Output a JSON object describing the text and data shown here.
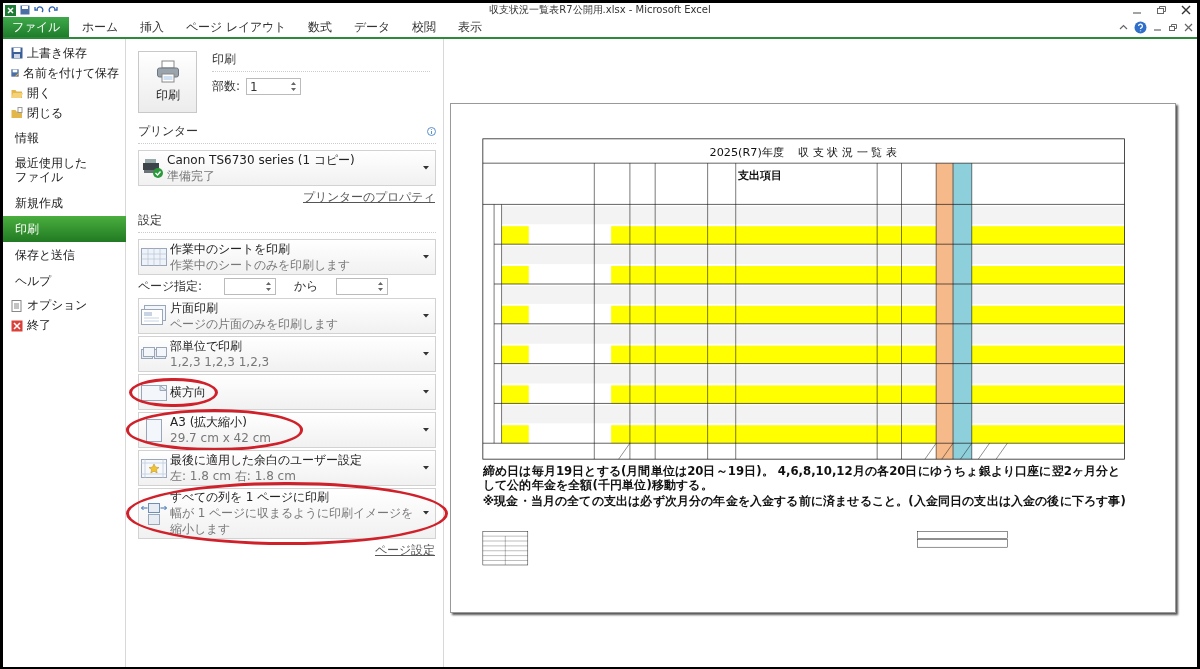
{
  "window": {
    "title": "収支状況一覧表R7公開用.xlsx  -  Microsoft Excel"
  },
  "ribbon_tabs": [
    {
      "label": "ファイル",
      "selected": true
    },
    {
      "label": "ホーム",
      "selected": false
    },
    {
      "label": "挿入",
      "selected": false
    },
    {
      "label": "ページ レイアウト",
      "selected": false
    },
    {
      "label": "数式",
      "selected": false
    },
    {
      "label": "データ",
      "selected": false
    },
    {
      "label": "校閲",
      "selected": false
    },
    {
      "label": "表示",
      "selected": false
    }
  ],
  "backstage_nav": [
    {
      "label": "上書き保存",
      "kind": "save",
      "selected": false
    },
    {
      "label": "名前を付けて保存",
      "kind": "save-as",
      "selected": false
    },
    {
      "label": "開く",
      "kind": "open",
      "selected": false
    },
    {
      "label": "閉じる",
      "kind": "close",
      "selected": false
    },
    {
      "label": "情報",
      "kind": "section",
      "selected": false
    },
    {
      "label": "最近使用したファイル",
      "kind": "section",
      "selected": false
    },
    {
      "label": "新規作成",
      "kind": "section",
      "selected": false
    },
    {
      "label": "印刷",
      "kind": "section",
      "selected": true
    },
    {
      "label": "保存と送信",
      "kind": "section",
      "selected": false
    },
    {
      "label": "ヘルプ",
      "kind": "section",
      "selected": false
    },
    {
      "label": "オプション",
      "kind": "options",
      "selected": false
    },
    {
      "label": "終了",
      "kind": "exit",
      "selected": false
    }
  ],
  "print_panel": {
    "heading": "印刷",
    "button": "印刷",
    "copies_label": "部数:",
    "copies": "1"
  },
  "printer": {
    "heading": "プリンター",
    "name": "Canon TS6730 series (1 コピー)",
    "status": "準備完了",
    "properties_link": "プリンターのプロパティ"
  },
  "settings": {
    "heading": "設定",
    "items": [
      {
        "kind": "what",
        "title": "作業中のシートを印刷",
        "subtitle": "作業中のシートのみを印刷します",
        "circled": false
      },
      {
        "kind": "page_range",
        "label": "ページ指定:",
        "to_label": "から"
      },
      {
        "kind": "sides",
        "title": "片面印刷",
        "subtitle": "ページの片面のみを印刷します",
        "circled": false
      },
      {
        "kind": "collate",
        "title": "部単位で印刷",
        "subtitle": "1,2,3    1,2,3    1,2,3",
        "circled": false
      },
      {
        "kind": "orientation",
        "title": "横方向",
        "circled": true
      },
      {
        "kind": "paper",
        "title": "A3 (拡大縮小)",
        "subtitle": "29.7 cm x 42 cm",
        "circled": true
      },
      {
        "kind": "margins",
        "title": "最後に適用した余白のユーザー設定",
        "subtitle": "左:  1.8 cm    右:  1.8 cm",
        "circled": false
      },
      {
        "kind": "scaling",
        "title": "すべての列を 1 ページに印刷",
        "subtitle": "幅が 1 ページに収まるように印刷イメージを縮小します",
        "circled": true
      }
    ],
    "page_setup_link": "ページ設定"
  },
  "preview": {
    "title": "2025(R7)年度　 収 支 状 況 一 覧 表",
    "expense_header": "支出項目",
    "rows": [
      {
        "highlighted": false
      },
      {
        "highlighted": true
      },
      {
        "highlighted": false
      },
      {
        "highlighted": true
      },
      {
        "highlighted": false
      },
      {
        "highlighted": true
      },
      {
        "highlighted": false
      },
      {
        "highlighted": true
      },
      {
        "highlighted": false
      },
      {
        "highlighted": true
      },
      {
        "highlighted": false
      },
      {
        "highlighted": true
      }
    ],
    "notes": [
      "締め日は毎月19日とする(月間単位は20日～19日)。 4,6,8,10,12月の各20日にゆうちょ銀より口座に翌2ヶ月分として公的年金を全額(千円単位)移動する。",
      "※現金・当月の全ての支出は必ず次月分の年金を入金する前に済ませること。(入金同日の支出は入金の後に下ろす事)"
    ]
  }
}
